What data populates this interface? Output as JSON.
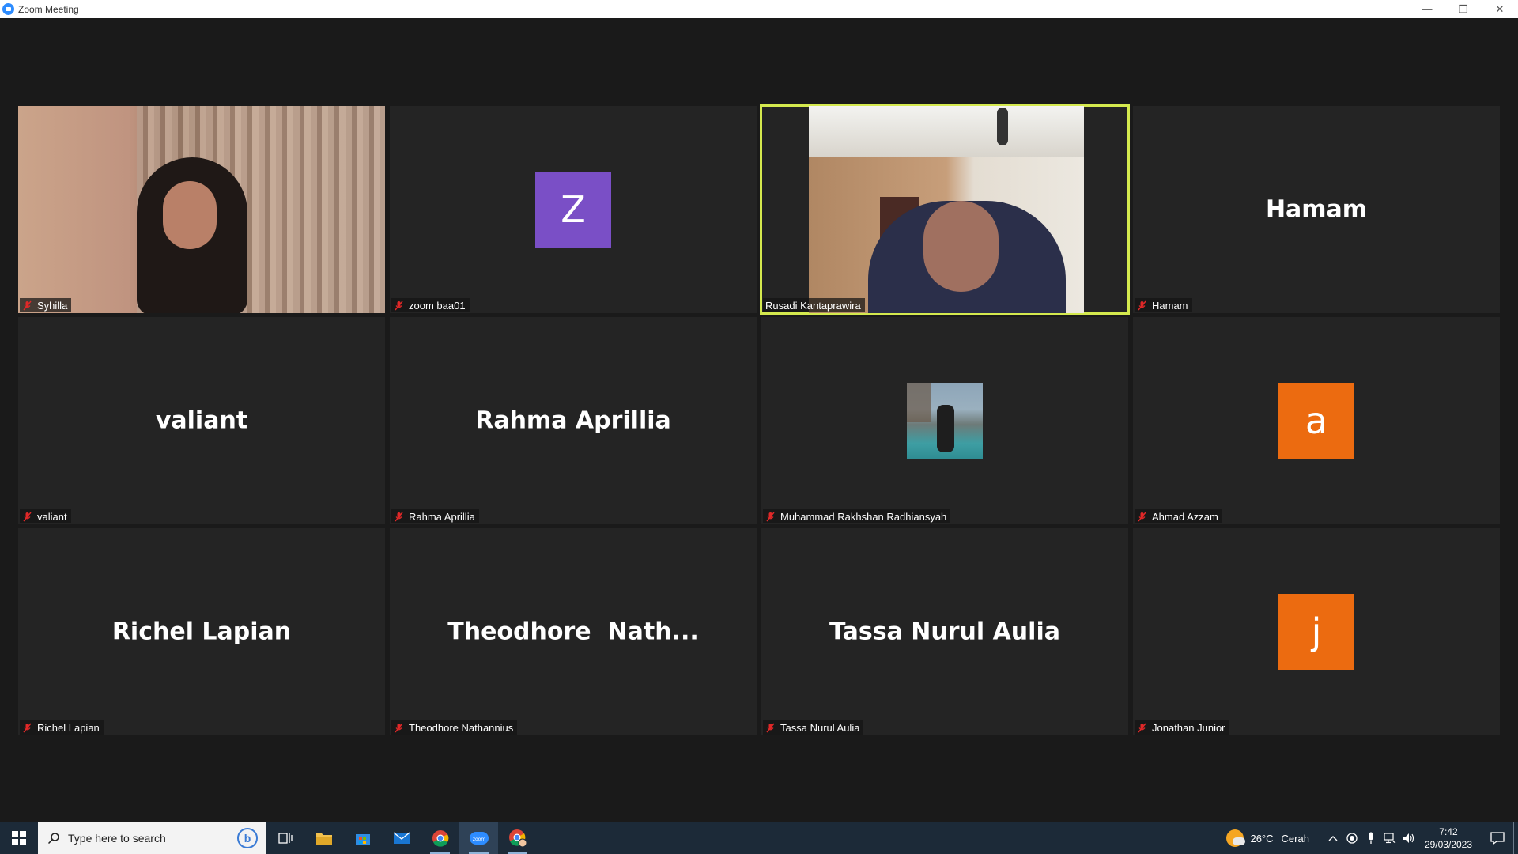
{
  "window": {
    "title": "Zoom Meeting",
    "minimize": "—",
    "restore": "❐",
    "close": "✕"
  },
  "participants": [
    {
      "name": "Syhilla",
      "display": "video",
      "muted": true,
      "active": false
    },
    {
      "name": "zoom baa01",
      "display": "avatar",
      "avatar_letter": "Z",
      "avatar_color": "#7a4fc6",
      "muted": true,
      "active": false
    },
    {
      "name": "Rusadi Kantaprawira",
      "display": "video",
      "muted": false,
      "active": true
    },
    {
      "name": "Hamam",
      "display": "name",
      "big_name": "Hamam",
      "muted": true,
      "active": false
    },
    {
      "name": "valiant",
      "display": "name",
      "big_name": "valiant",
      "muted": true,
      "active": false
    },
    {
      "name": "Rahma Aprillia",
      "display": "name",
      "big_name": "Rahma Aprillia",
      "muted": true,
      "active": false
    },
    {
      "name": "Muhammad Rakhshan Radhiansyah",
      "display": "photo",
      "muted": true,
      "active": false
    },
    {
      "name": "Ahmad Azzam",
      "display": "avatar",
      "avatar_letter": "a",
      "avatar_color": "#ec6b10",
      "muted": true,
      "active": false
    },
    {
      "name": "Richel Lapian",
      "display": "name",
      "big_name": "Richel Lapian",
      "muted": true,
      "active": false
    },
    {
      "name": "Theodhore Nathannius",
      "display": "name",
      "big_name": "Theodhore  Nath...",
      "muted": true,
      "active": false
    },
    {
      "name": "Tassa Nurul Aulia",
      "display": "name",
      "big_name": "Tassa Nurul Aulia",
      "muted": true,
      "active": false
    },
    {
      "name": "Jonathan Junior",
      "display": "avatar",
      "avatar_letter": "j",
      "avatar_color": "#ec6b10",
      "muted": true,
      "active": false
    }
  ],
  "colors": {
    "active_speaker_border": "#d4e94e",
    "muted_mic": "#e02828"
  },
  "taskbar": {
    "search_placeholder": "Type here to search",
    "apps": [
      "task-view-icon",
      "file-explorer-icon",
      "microsoft-store-icon",
      "mail-icon",
      "chrome-icon",
      "zoom-icon",
      "chrome-profile-icon"
    ],
    "weather_temp": "26°C",
    "weather_text": "Cerah",
    "time": "7:42",
    "date": "29/03/2023"
  }
}
